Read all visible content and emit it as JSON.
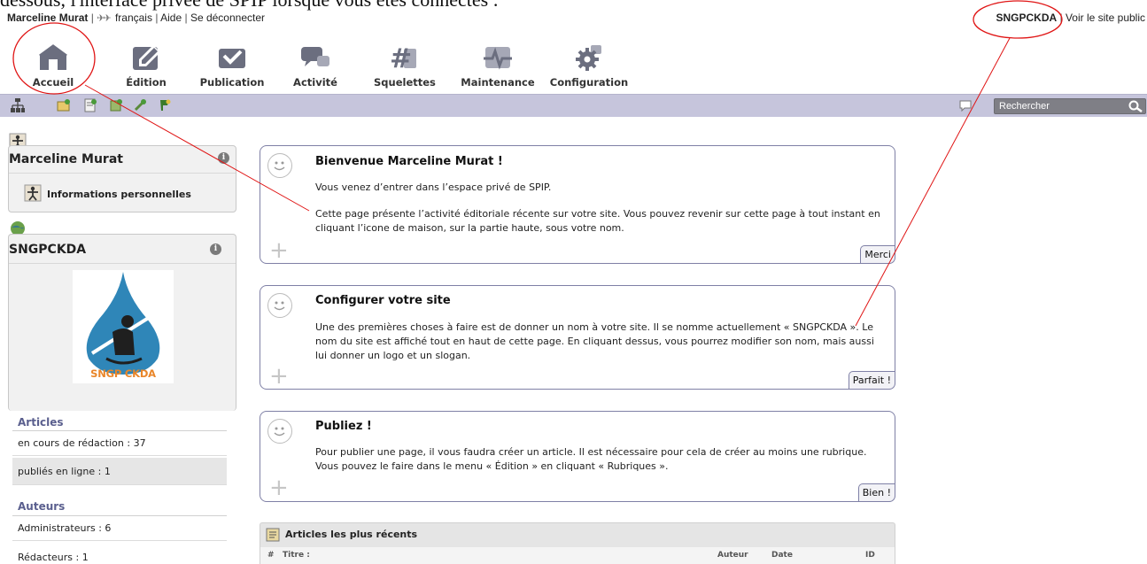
{
  "caption": "dessous, l'interface privée de SPIP lorsque vous êtes connectés :",
  "topbar": {
    "user": "Marceline Murat",
    "language": "français",
    "help": "Aide",
    "logout": "Se déconnecter",
    "site": "SNGPCKDA",
    "view_site": "Voir le site public"
  },
  "nav": [
    {
      "label": "Accueil",
      "icon": "home-icon"
    },
    {
      "label": "Édition",
      "icon": "pencil-icon"
    },
    {
      "label": "Publication",
      "icon": "checkmark-icon"
    },
    {
      "label": "Activité",
      "icon": "chat-bubbles-icon"
    },
    {
      "label": "Squelettes",
      "icon": "hash-icon"
    },
    {
      "label": "Maintenance",
      "icon": "pulse-icon"
    },
    {
      "label": "Configuration",
      "icon": "gear-icon"
    }
  ],
  "toolbar": {
    "search_placeholder": "Rechercher"
  },
  "sidebar": {
    "user_card": {
      "name": "Marceline Murat",
      "link": "Informations personnelles"
    },
    "site_card": {
      "name": "SNGPCKDA",
      "logo_text": "SNGP CKDA"
    },
    "articles": {
      "heading": "Articles",
      "rows": [
        "en cours de rédaction : 37",
        "publiés en ligne : 1"
      ]
    },
    "authors": {
      "heading": "Auteurs",
      "rows": [
        "Administrateurs : 6",
        "Rédacteurs : 1"
      ]
    }
  },
  "messages": [
    {
      "title": "Bienvenue Marceline Murat !",
      "paragraphs": [
        "Vous venez d’entrer dans l’espace privé de SPIP.",
        "Cette page présente l’activité éditoriale récente sur votre site. Vous pouvez revenir sur cette page à tout instant en cliquant l’icone de maison, sur la partie haute, sous votre nom."
      ],
      "button": "Merci"
    },
    {
      "title": "Configurer votre site",
      "paragraphs": [
        "Une des premières choses à faire est de donner un nom à votre site. Il se nomme actuellement « SNGPCKDA ». Le nom du site est affiché tout en haut de cette page. En cliquant dessus, vous pourrez modifier son nom, mais aussi lui donner un logo et un slogan."
      ],
      "button": "Parfait !"
    },
    {
      "title": "Publiez !",
      "paragraphs": [
        "Pour publier une page, il vous faudra créer un article. Il est nécessaire pour cela de créer au moins une rubrique. Vous pouvez le faire dans le menu « Édition » en cliquant « Rubriques »."
      ],
      "button": "Bien !"
    }
  ],
  "recent": {
    "title": "Articles les plus récents",
    "columns": [
      "#",
      "Titre :",
      "Auteur",
      "Date",
      "ID"
    ]
  },
  "colors": {
    "toolbar_bg": "#c6c5dc",
    "box_border": "#7f80a6",
    "stat_heading": "#5a5f8e",
    "annotation": "#e01515"
  }
}
